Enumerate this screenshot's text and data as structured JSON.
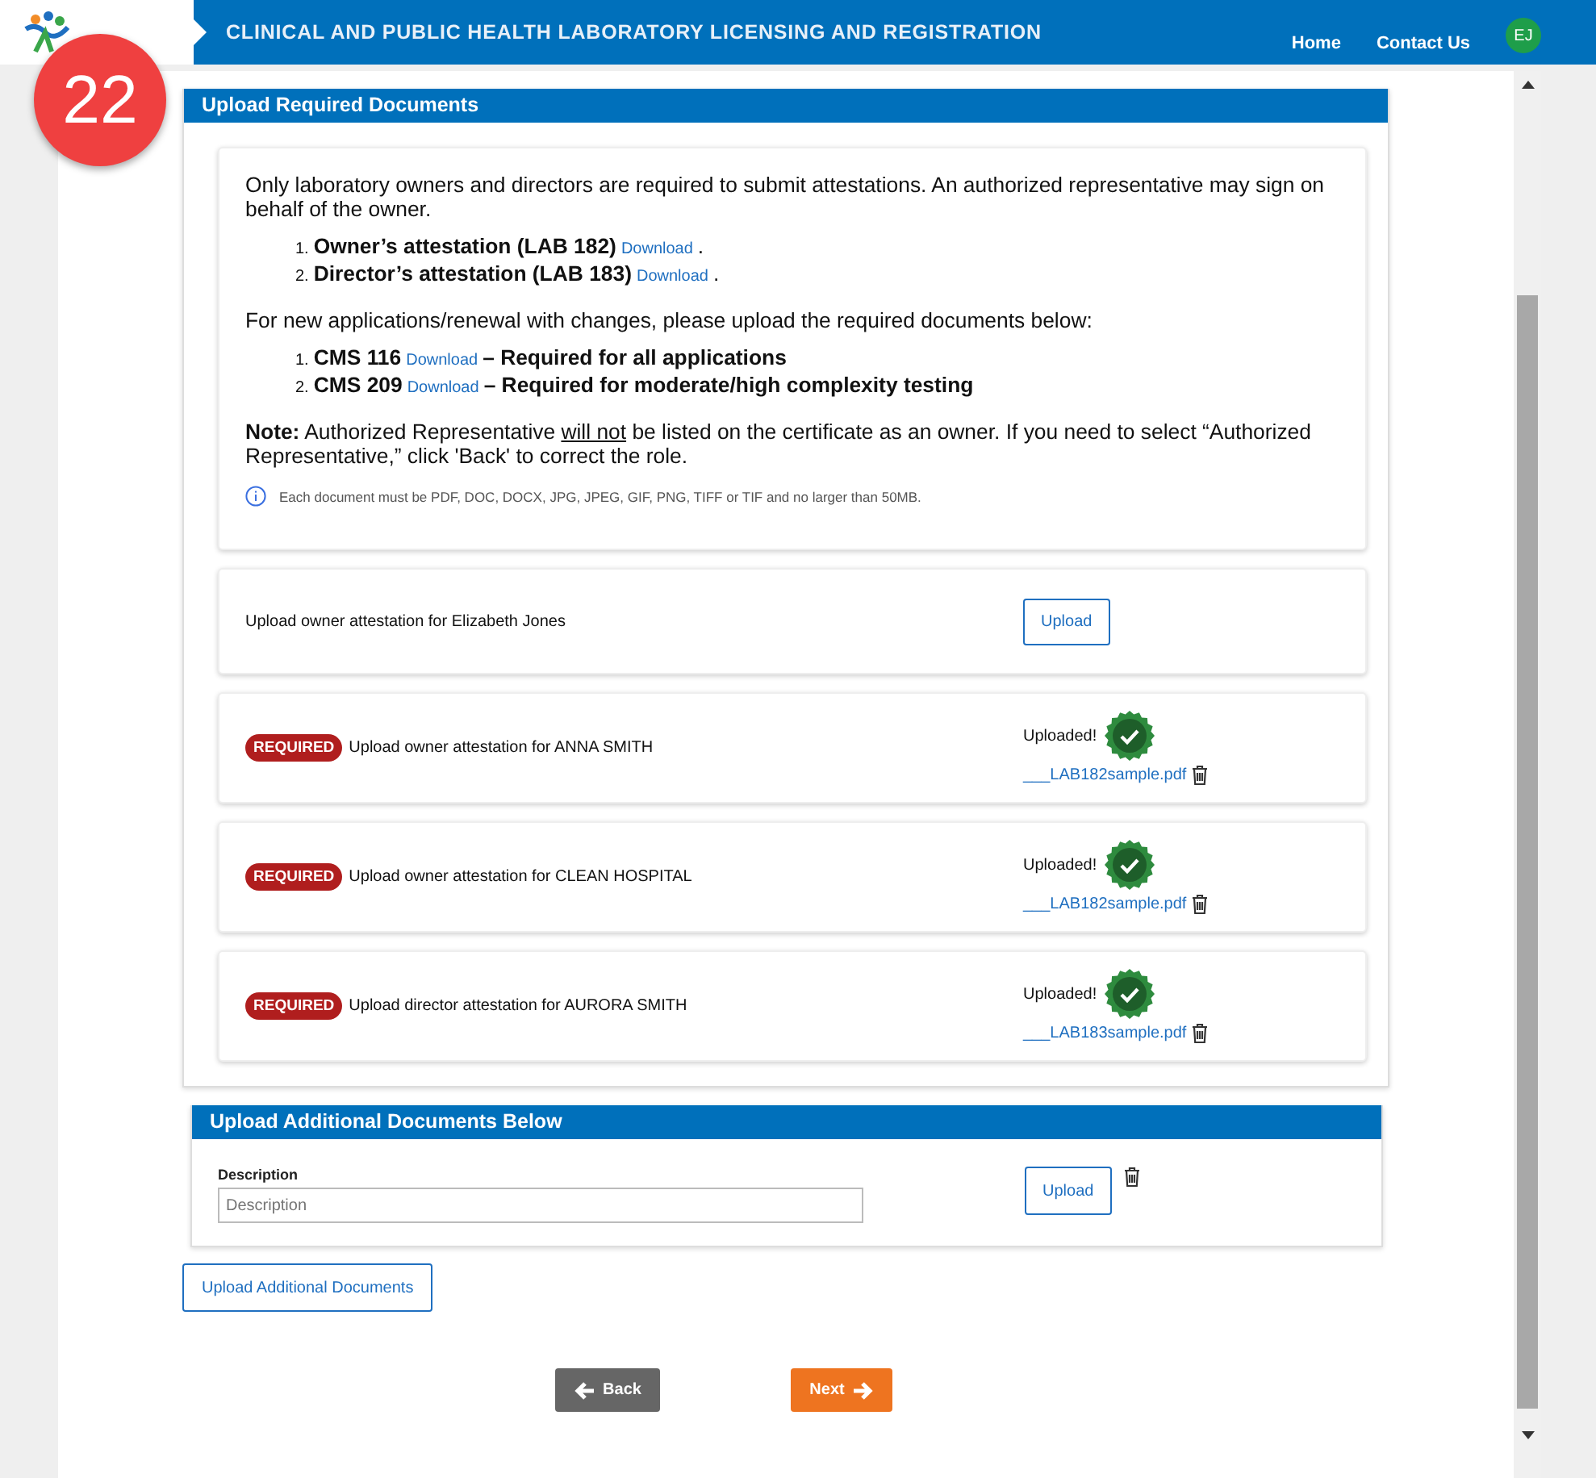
{
  "header": {
    "title": "CLINICAL AND PUBLIC HEALTH LABORATORY LICENSING AND REGISTRATION",
    "nav": [
      {
        "label": "Home"
      },
      {
        "label": "Contact Us"
      }
    ],
    "avatar": "EJ"
  },
  "step_badge": "22",
  "required_section": {
    "title": "Upload Required Documents",
    "intro": "Only laboratory owners and directors are required to submit attestations. An authorized representative may sign on behalf of the owner.",
    "attestations": [
      {
        "number": "1.",
        "name": "Owner’s attestation (LAB 182)",
        "link": "Download",
        "suffix": "."
      },
      {
        "number": "2.",
        "name": "Director’s attestation (LAB 183)",
        "link": "Download",
        "suffix": "."
      }
    ],
    "instruction": "For new applications/renewal with changes, please upload the required documents below:",
    "documents": [
      {
        "number": "1.",
        "name": "CMS 116",
        "link": "Download",
        "note": "– Required for all applications"
      },
      {
        "number": "2.",
        "name": "CMS 209",
        "link": "Download",
        "note": "– Required for moderate/high complexity testing"
      }
    ],
    "note": {
      "label": "Note:",
      "before": " Authorized Representative ",
      "underlined": "will not",
      "after": " be listed on the certificate as an owner. If you need to select “Authorized Representative,” click 'Back' to correct the role."
    },
    "file_info": "Each document must be PDF, DOC, DOCX, JPG, JPEG, GIF, PNG, TIFF or TIF and no larger than 50MB.",
    "uploads": [
      {
        "label": "Upload owner attestation for Elizabeth Jones",
        "required": false,
        "uploaded": false,
        "button": "Upload"
      },
      {
        "label": "Upload owner attestation for ANNA SMITH",
        "required": true,
        "badge": "REQUIRED",
        "uploaded": true,
        "status": "Uploaded!",
        "file": "___LAB182sample.pdf"
      },
      {
        "label": "Upload owner attestation for CLEAN HOSPITAL",
        "required": true,
        "badge": "REQUIRED",
        "uploaded": true,
        "status": "Uploaded!",
        "file": "___LAB182sample.pdf"
      },
      {
        "label": "Upload director attestation for AURORA SMITH",
        "required": true,
        "badge": "REQUIRED",
        "uploaded": true,
        "status": "Uploaded!",
        "file": "___LAB183sample.pdf"
      }
    ]
  },
  "additional_section": {
    "title": "Upload Additional Documents Below",
    "field_label": "Description",
    "placeholder": "Description",
    "button": "Upload"
  },
  "add_button": "Upload Additional Documents",
  "back": "Back",
  "next": "Next"
}
